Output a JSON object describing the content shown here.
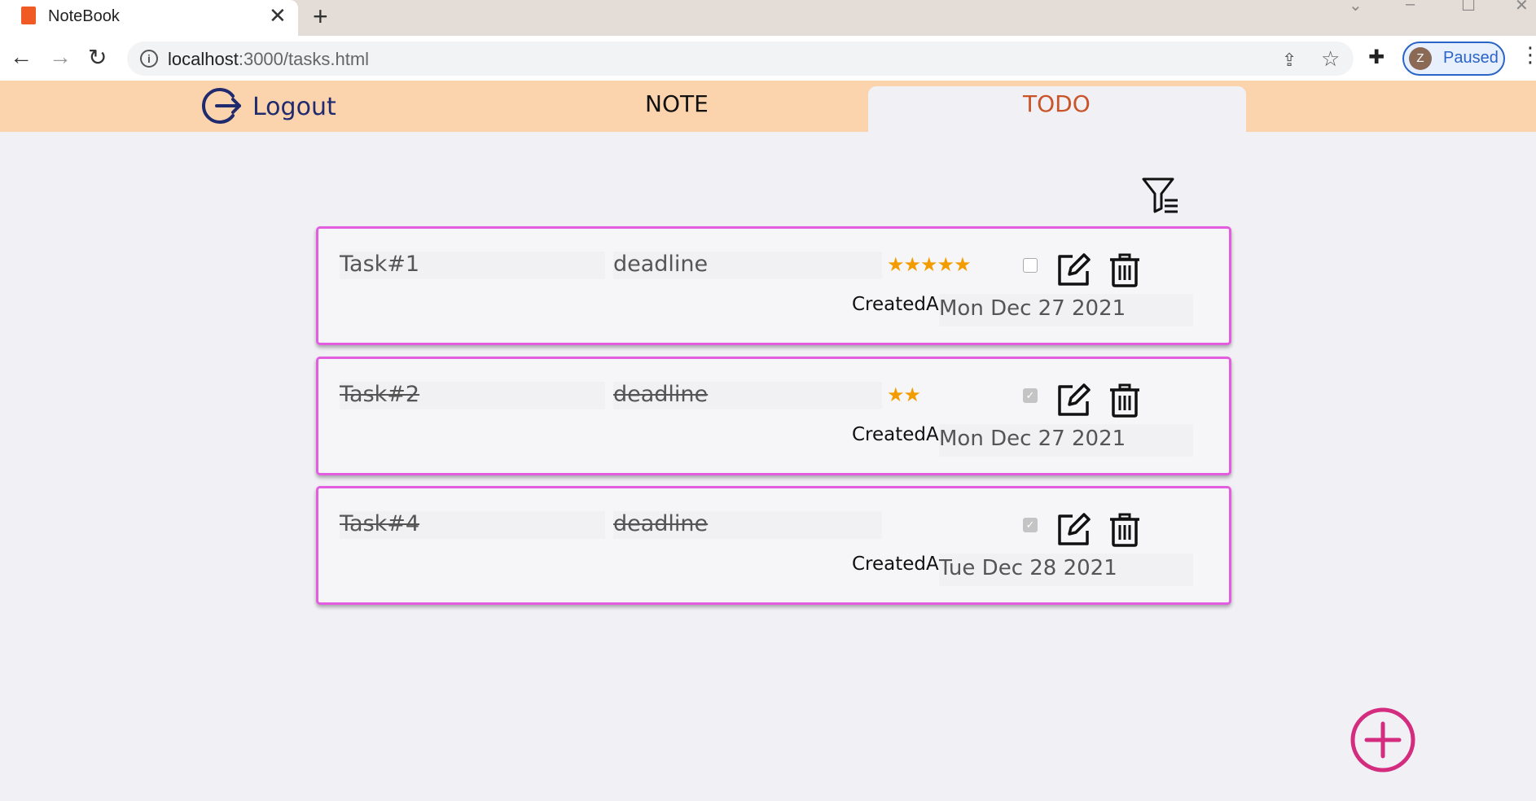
{
  "browser": {
    "tab_title": "NoteBook",
    "tab_close": "✕",
    "new_tab": "+",
    "url_host": "localhost",
    "url_rest": ":3000/tasks.html",
    "profile_initial": "Z",
    "profile_status": "Paused"
  },
  "header": {
    "logout_label": "Logout",
    "note_label": "NOTE",
    "todo_label": "TODO",
    "active_tab": "TODO"
  },
  "tasks": [
    {
      "name": "Task#1",
      "deadline": "deadline",
      "stars": "★★★★★",
      "rating": 5,
      "done": false,
      "created_label": "CreatedAt:",
      "created_at": "Mon Dec 27 2021"
    },
    {
      "name": "Task#2",
      "deadline": "deadline",
      "stars": "★★",
      "rating": 2,
      "done": true,
      "created_label": "CreatedAt:",
      "created_at": "Mon Dec 27 2021"
    },
    {
      "name": "Task#4",
      "deadline": "deadline",
      "stars": "",
      "rating": 0,
      "done": true,
      "created_label": "CreatedAt:",
      "created_at": "Tue Dec 28 2021"
    }
  ],
  "colors": {
    "header_bg": "#fbd3ac",
    "accent_todo": "#c9542a",
    "card_border": "#e35de0",
    "star": "#f29c00",
    "add_button": "#d42c7e",
    "logout": "#1f2b6e"
  },
  "icons": {
    "logout": "logout-icon",
    "filter": "filter-icon",
    "edit": "edit-icon",
    "delete": "trash-icon",
    "add": "plus-circle-icon"
  }
}
